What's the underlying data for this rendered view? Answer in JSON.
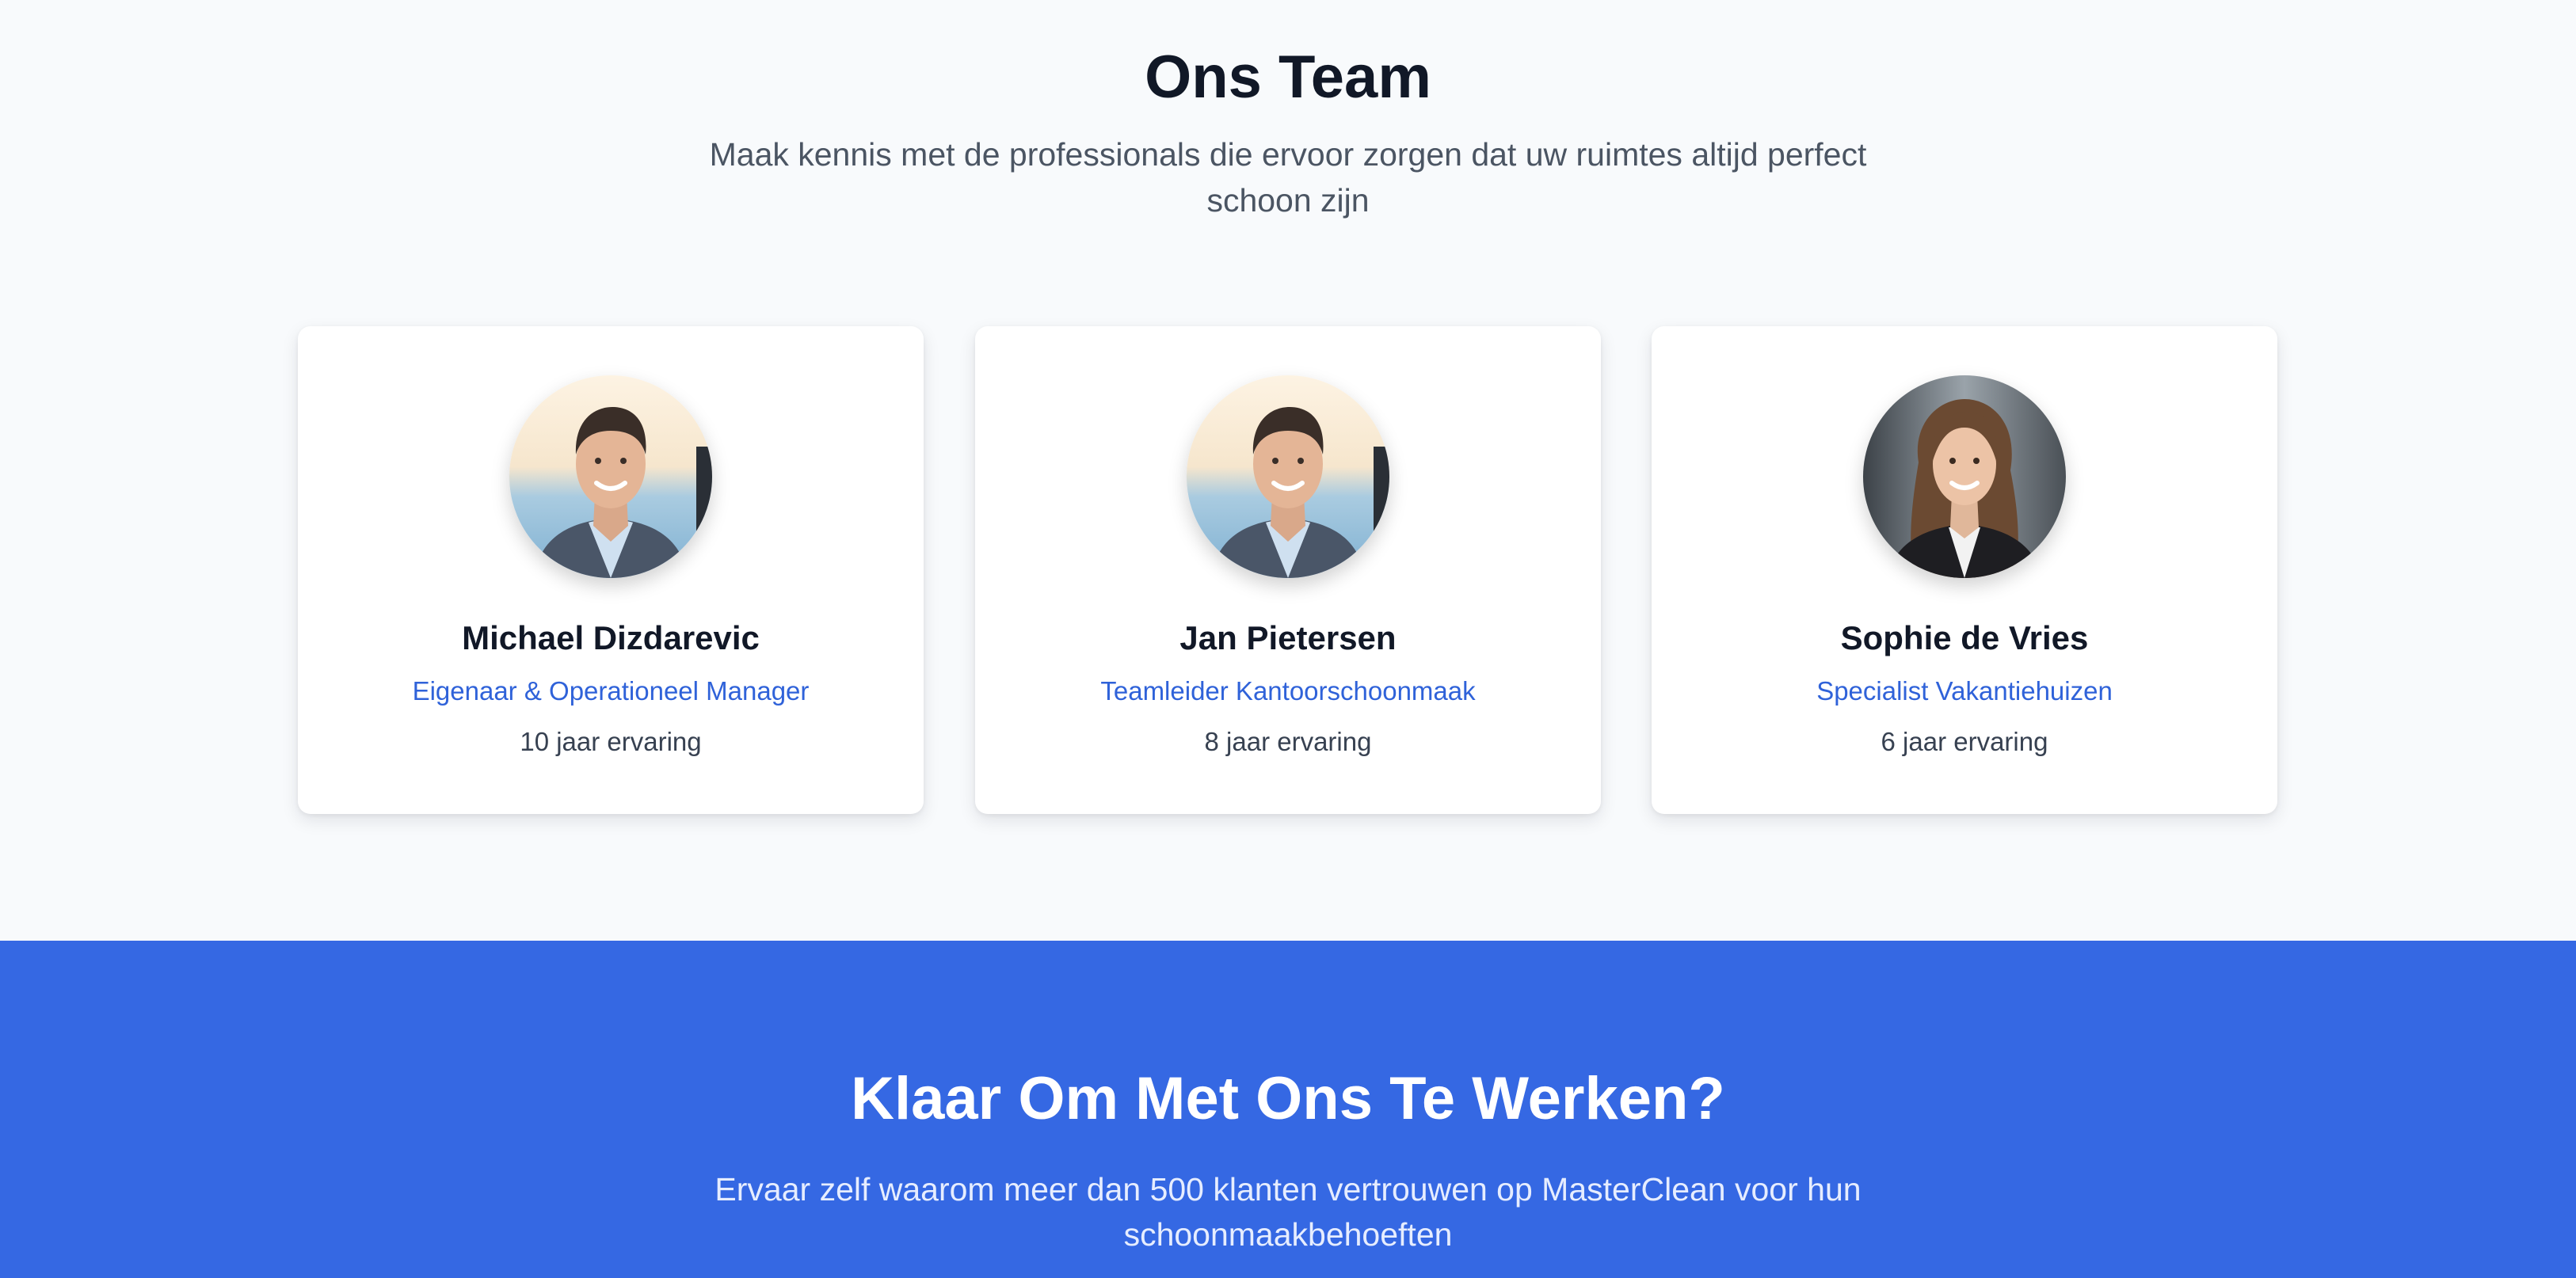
{
  "team": {
    "title": "Ons Team",
    "subtitle": "Maak kennis met de professionals die ervoor zorgen dat uw ruimtes altijd perfect schoon zijn",
    "members": [
      {
        "name": "Michael Dizdarevic",
        "role": "Eigenaar & Operationeel Manager",
        "experience": "10 jaar ervaring",
        "avatar_icon": "man-portrait-avatar"
      },
      {
        "name": "Jan Pietersen",
        "role": "Teamleider Kantoorschoonmaak",
        "experience": "8 jaar ervaring",
        "avatar_icon": "man-portrait-avatar"
      },
      {
        "name": "Sophie de Vries",
        "role": "Specialist Vakantiehuizen",
        "experience": "6 jaar ervaring",
        "avatar_icon": "woman-portrait-avatar"
      }
    ]
  },
  "cta": {
    "title": "Klaar Om Met Ons Te Werken?",
    "subtitle": "Ervaar zelf waarom meer dan 500 klanten vertrouwen op MasterClean voor hun schoonmaakbehoeften"
  },
  "colors": {
    "page_background": "#f8fafc",
    "heading": "#111827",
    "muted_text": "#4b5563",
    "accent_blue": "#2f62d9",
    "cta_background": "#3568e3",
    "card_background": "#ffffff"
  }
}
